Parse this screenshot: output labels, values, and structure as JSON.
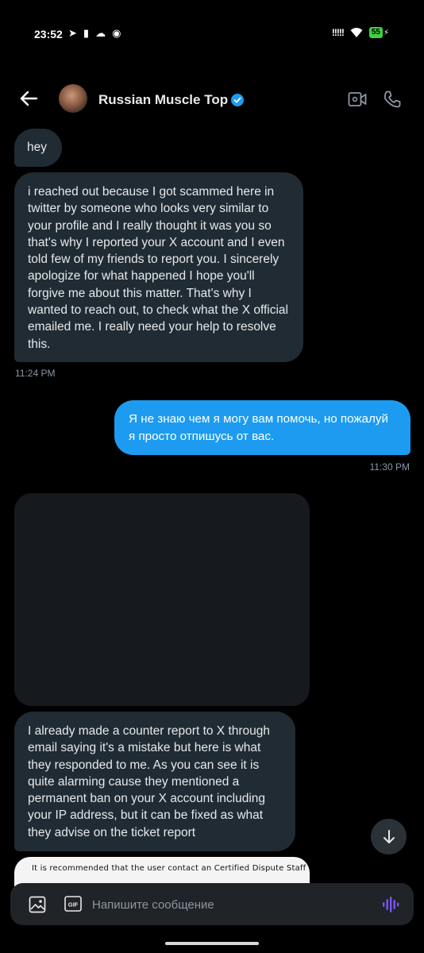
{
  "status_bar": {
    "time": "23:52",
    "battery": "55"
  },
  "header": {
    "contact_name": "Russian Muscle Top"
  },
  "messages": [
    {
      "text": "hey"
    },
    {
      "text": "i  reached out because I got scammed here in twitter by someone who looks very similar to your profile and I really thought it was you so that's why I reported your X account and I even told few of my friends to report you. I sincerely apologize for what happened I hope you'll forgive me about this matter. That's why I wanted to reach out, to check what the X official emailed me. I really need your help to resolve this."
    },
    {
      "text": "Я не знаю чем я могу вам помочь, но пожалуй я просто отпишусь от вас."
    },
    {
      "text": "I already made a counter report to X through email saying it's a mistake but here is what they responded to me. As you can see it is quite alarming cause they mentioned a permanent ban on your X account including your IP address, but it can be fixed as what they advise on the ticket report"
    }
  ],
  "timestamps": {
    "first": "11:24 PM",
    "second": "11:30 PM"
  },
  "preview_card": {
    "text": "It is recommended that the user contact an Certified Dispute Staff"
  },
  "composer": {
    "placeholder": "Напишите сообщение",
    "gif_label": "GIF"
  },
  "colors": {
    "background": "#000000",
    "incoming_bubble": "#202b33",
    "outgoing_bubble": "#1d9bf0",
    "verified": "#1d9bf0",
    "voice_accent": "#7856ff"
  }
}
